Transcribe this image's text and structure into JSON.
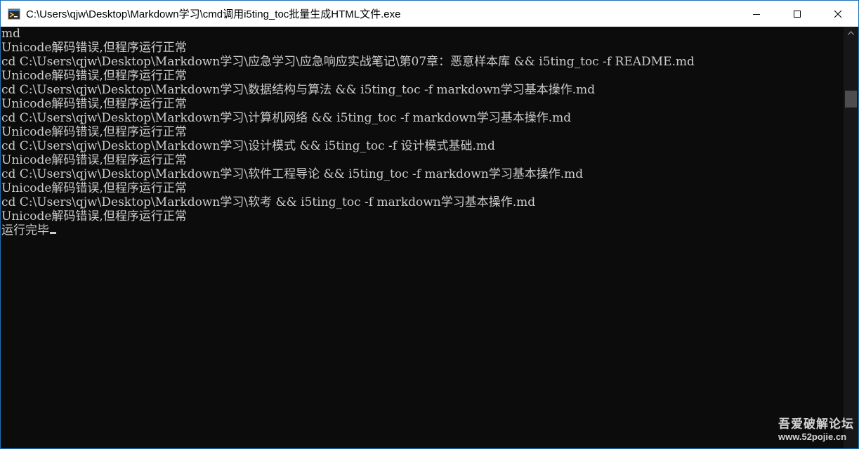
{
  "window": {
    "title": "C:\\Users\\qjw\\Desktop\\Markdown学习\\cmd调用i5ting_toc批量生成HTML文件.exe",
    "border_color": "#1f6fb5",
    "background": "#0c0c0c",
    "foreground": "#cccccc"
  },
  "title_bar": {
    "app_icon": "console-app-icon",
    "minimize_icon": "minimize-icon",
    "maximize_icon": "maximize-icon",
    "close_icon": "close-icon"
  },
  "console": {
    "lines": [
      "md",
      "Unicode解码错误,但程序运行正常",
      "cd C:\\Users\\qjw\\Desktop\\Markdown学习\\应急学习\\应急响应实战笔记\\第07章：恶意样本库 && i5ting_toc -f README.md",
      "Unicode解码错误,但程序运行正常",
      "cd C:\\Users\\qjw\\Desktop\\Markdown学习\\数据结构与算法 && i5ting_toc -f markdown学习基本操作.md",
      "Unicode解码错误,但程序运行正常",
      "cd C:\\Users\\qjw\\Desktop\\Markdown学习\\计算机网络 && i5ting_toc -f markdown学习基本操作.md",
      "Unicode解码错误,但程序运行正常",
      "cd C:\\Users\\qjw\\Desktop\\Markdown学习\\设计模式 && i5ting_toc -f 设计模式基础.md",
      "Unicode解码错误,但程序运行正常",
      "cd C:\\Users\\qjw\\Desktop\\Markdown学习\\软件工程导论 && i5ting_toc -f markdown学习基本操作.md",
      "Unicode解码错误,但程序运行正常",
      "cd C:\\Users\\qjw\\Desktop\\Markdown学习\\软考 && i5ting_toc -f markdown学习基本操作.md",
      "Unicode解码错误,但程序运行正常",
      "运行完毕"
    ]
  },
  "watermark": {
    "title": "吾爱破解论坛",
    "url": "www.52pojie.cn"
  }
}
